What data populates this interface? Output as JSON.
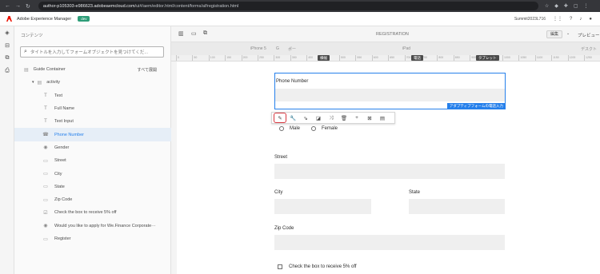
{
  "browser": {
    "nav": [
      "←",
      "→",
      "↻"
    ],
    "url_host": "author-p105303-e986623.adobeaemcloud.com",
    "url_path": "/ui#/aem/editor.html/content/forms/af/registration.html",
    "extensions": [
      "☆",
      "◆",
      "✚",
      "▢",
      "⋮"
    ]
  },
  "aem": {
    "product": "Adobe Experience Manager",
    "env_badge": "dev",
    "user": "Summit2023L716",
    "icons": [
      "grid-icon",
      "help-icon",
      "bell-icon",
      "user-icon"
    ]
  },
  "rail": {
    "icons": [
      "◈",
      "⊟",
      "⧉",
      "⎙"
    ]
  },
  "side_panel": {
    "title": "コンテンツ",
    "search_placeholder": "タイトルを入力してフォームオブジェクトを見つけてくだ...",
    "root_label": "Guide Container",
    "expand_all": "すべて展開",
    "folder_label": "activity",
    "items": [
      {
        "icon": "T",
        "label": "Text"
      },
      {
        "icon": "T",
        "label": "Full Name"
      },
      {
        "icon": "T",
        "label": "Text Input"
      },
      {
        "icon": "☎",
        "label": "Phone Number"
      },
      {
        "icon": "◉",
        "label": "Gender"
      },
      {
        "icon": "▭",
        "label": "Street"
      },
      {
        "icon": "▭",
        "label": "City"
      },
      {
        "icon": "▭",
        "label": "State"
      },
      {
        "icon": "▭",
        "label": "Zip Code"
      },
      {
        "icon": "☑",
        "label": "Check the box to receive 5% off"
      },
      {
        "icon": "◉",
        "label": "Would you like to apply for We.Finance Corporate···"
      },
      {
        "icon": "▭",
        "label": "Register"
      }
    ],
    "selected_index": 3
  },
  "toolbar": {
    "page_name": "REGISTRATION",
    "mode_label": "編集",
    "preview_label": "プレビュー"
  },
  "device": {
    "labels": [
      "iPhone 5",
      "G",
      "ポー",
      "iPad",
      "デスクト"
    ],
    "tags": [
      "横幅",
      "電話",
      "タブレット"
    ]
  },
  "ruler_ticks": [
    "0",
    "50",
    "100",
    "150",
    "200",
    "250",
    "300",
    "350",
    "400",
    "450",
    "500",
    "550",
    "600",
    "650",
    "700",
    "750",
    "800",
    "850",
    "900",
    "950",
    "1000",
    "1050",
    "1100",
    "1150",
    "1200",
    "1250",
    "1300"
  ],
  "selection": {
    "label": "Phone Number",
    "badge": "アダプティブフォームの電話入力"
  },
  "edit_toolbar": [
    "✎",
    "🔧",
    "⇘",
    "◪",
    "⤨",
    "🗑",
    "+",
    "⊠",
    "▤"
  ],
  "form": {
    "gender_options": [
      "Male",
      "Female"
    ],
    "street_label": "Street",
    "city_label": "City",
    "state_label": "State",
    "zip_label": "Zip Code",
    "checkbox_label": "Check the box to receive 5% off"
  }
}
